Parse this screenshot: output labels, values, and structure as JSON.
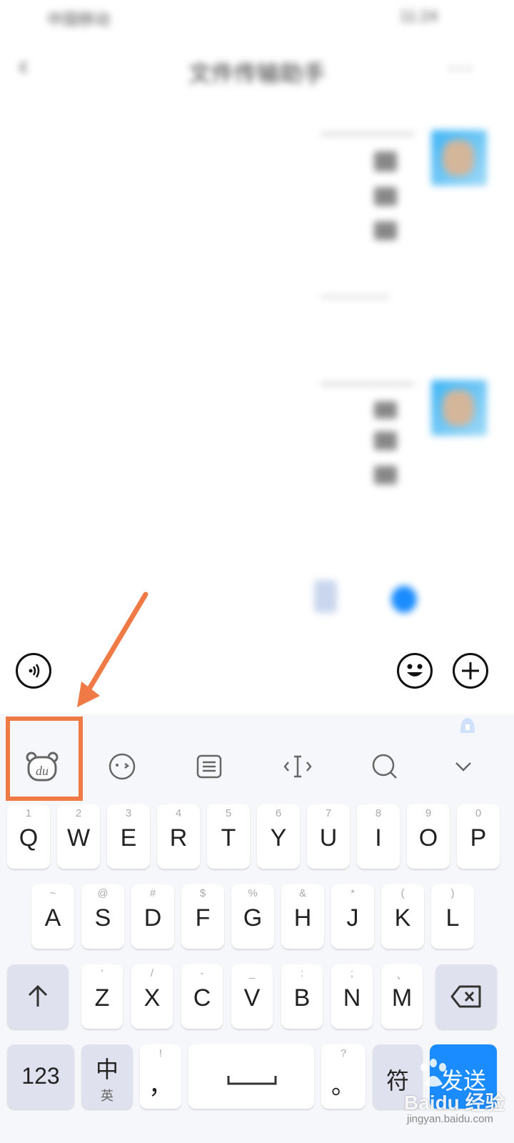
{
  "chat": {
    "title": "文件传输助手",
    "carrier": "中国移动",
    "time": "11:24"
  },
  "keyboard": {
    "toolbar": [
      "baidu-du-icon",
      "emoji-face-icon",
      "clipboard-icon",
      "cursor-move-icon",
      "search-icon",
      "collapse-icon"
    ],
    "row1": [
      {
        "main": "Q",
        "sub": "1"
      },
      {
        "main": "W",
        "sub": "2"
      },
      {
        "main": "E",
        "sub": "3"
      },
      {
        "main": "R",
        "sub": "4"
      },
      {
        "main": "T",
        "sub": "5"
      },
      {
        "main": "Y",
        "sub": "6"
      },
      {
        "main": "U",
        "sub": "7"
      },
      {
        "main": "I",
        "sub": "8"
      },
      {
        "main": "O",
        "sub": "9"
      },
      {
        "main": "P",
        "sub": "0"
      }
    ],
    "row2": [
      {
        "main": "A",
        "sub": "~"
      },
      {
        "main": "S",
        "sub": "@"
      },
      {
        "main": "D",
        "sub": "#"
      },
      {
        "main": "F",
        "sub": "$"
      },
      {
        "main": "G",
        "sub": "%"
      },
      {
        "main": "H",
        "sub": "&"
      },
      {
        "main": "J",
        "sub": "*"
      },
      {
        "main": "K",
        "sub": "("
      },
      {
        "main": "L",
        "sub": ")"
      }
    ],
    "row3": [
      {
        "main": "Z",
        "sub": "'"
      },
      {
        "main": "X",
        "sub": "/"
      },
      {
        "main": "C",
        "sub": "-"
      },
      {
        "main": "V",
        "sub": "_"
      },
      {
        "main": "B",
        "sub": ":"
      },
      {
        "main": "N",
        "sub": ";"
      },
      {
        "main": "M",
        "sub": "、"
      }
    ],
    "num_label": "123",
    "lang_main": "中",
    "lang_sub": "英",
    "comma_main": "，",
    "comma_sub": "!",
    "period_main": "。",
    "period_sub": "?",
    "symbol_label": "符",
    "send_label": "发送"
  },
  "watermark": {
    "brand": "Baidu 经验",
    "url": "jingyan.baidu.com"
  },
  "colors": {
    "accent_blue": "#1a8cff",
    "highlight_box": "#f07a45",
    "fn_key": "#dfe2ee"
  }
}
